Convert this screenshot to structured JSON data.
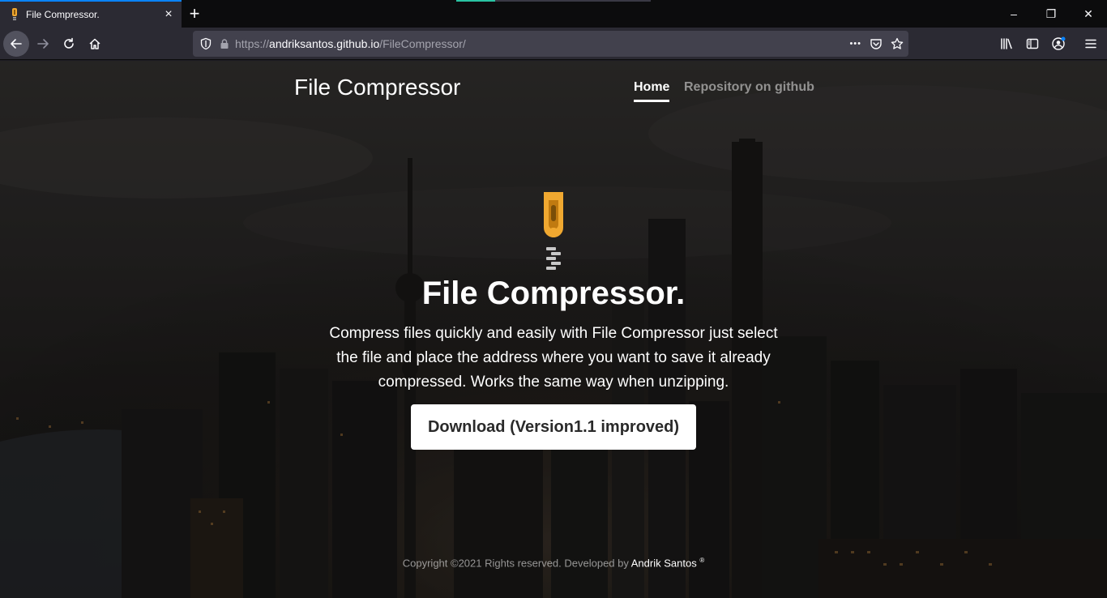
{
  "browser": {
    "tab_title": "File Compressor.",
    "new_tab_symbol": "+",
    "close_tab_symbol": "×",
    "url_scheme": "https://",
    "url_host": "andriksantos.github.io",
    "url_path": "/FileCompressor/",
    "url_more_symbol": "•••",
    "window_minimize": "–",
    "window_restore": "❐",
    "window_close": "✕",
    "icons": [
      "back-arrow-icon",
      "forward-arrow-icon",
      "reload-icon",
      "home-icon",
      "shield-icon",
      "lock-icon",
      "pocket-icon",
      "star-icon",
      "library-icon",
      "sidebar-icon",
      "account-icon",
      "menu-icon"
    ]
  },
  "site": {
    "brand": "File Compressor",
    "nav": {
      "home": "Home",
      "repo": "Repository on github"
    },
    "hero": {
      "title": "File Compressor.",
      "lead": "Compress files quickly and easily with File Compressor just select the file and place the address where you want to save it already compressed. Works the same way when unzipping.",
      "download_label": "Download (Version1.1 improved)"
    },
    "footer": {
      "copyright": "Copyright ©2021 Rights reserved. Developed by ",
      "author": "Andrik Santos",
      "mark": "®"
    }
  },
  "colors": {
    "accent": "#0a84ff",
    "zipper": "#f0a830",
    "zipper_pull": "#c07a10"
  }
}
